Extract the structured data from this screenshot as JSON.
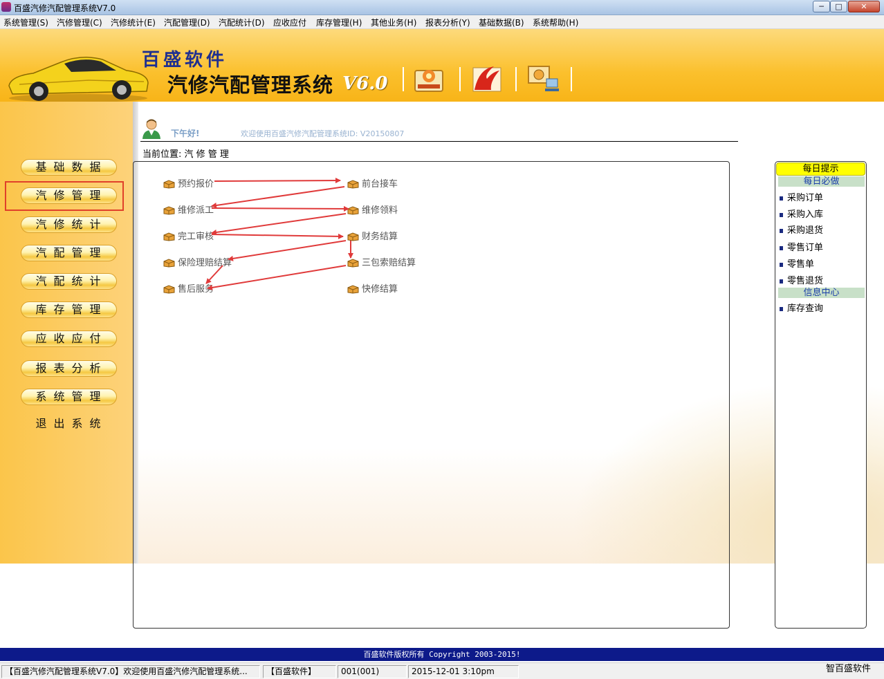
{
  "window": {
    "title": "百盛汽修汽配管理系统V7.0",
    "min_label": "─",
    "max_label": "□",
    "close_label": "✕"
  },
  "menu": [
    "系统管理(S)",
    "汽修管理(C)",
    "汽修统计(E)",
    "汽配管理(D)",
    "汽配统计(D)",
    "应收应付",
    "库存管理(H)",
    "其他业务(H)",
    "报表分析(Y)",
    "基础数据(B)",
    "系统帮助(H)"
  ],
  "banner": {
    "brand": "百盛软件",
    "system_name": "汽修汽配管理系统",
    "version": "V6.0"
  },
  "sidebar": {
    "items": [
      "基础数据",
      "汽修管理",
      "汽修统计",
      "汽配管理",
      "汽配统计",
      "库存管理",
      "应收应付",
      "报表分析",
      "系统管理"
    ],
    "exit": "退出系统",
    "selected": "汽修管理"
  },
  "greeting": {
    "text": "下午好!",
    "welcome": "欢迎使用百盛汽修汽配管理系统ID: V20150807"
  },
  "location": "当前位置: 汽 修 管 理",
  "workflow": {
    "left": [
      "预约报价",
      "维修派工",
      "完工审核",
      "保险理赔结算",
      "售后服务"
    ],
    "right": [
      "前台接车",
      "维修领料",
      "财务结算",
      "三包索赔结算",
      "快修结算"
    ]
  },
  "tips": {
    "header": "每日提示",
    "section1": "每日必做",
    "section1_items": [
      "采购订单",
      "采购入库",
      "采购退货",
      "零售订单",
      "零售单",
      "零售退货"
    ],
    "section2": "信息中心",
    "section2_items": [
      "库存查询"
    ]
  },
  "footer": "百盛软件版权所有 Copyright 2003-2015!",
  "status": {
    "app": "【百盛汽修汽配管理系统V7.0】欢迎使用百盛汽修汽配管理系统...",
    "company": "【百盛软件】",
    "user": "001(001)",
    "datetime": "2015-12-01 3:10pm",
    "corner": "智百盛软件"
  },
  "colors": {
    "banner": "#fbc02d",
    "footer": "#0d1a8a",
    "arrow": "#e03a3a",
    "highlight": "#e0402a",
    "tips_header": "#ffff00"
  }
}
